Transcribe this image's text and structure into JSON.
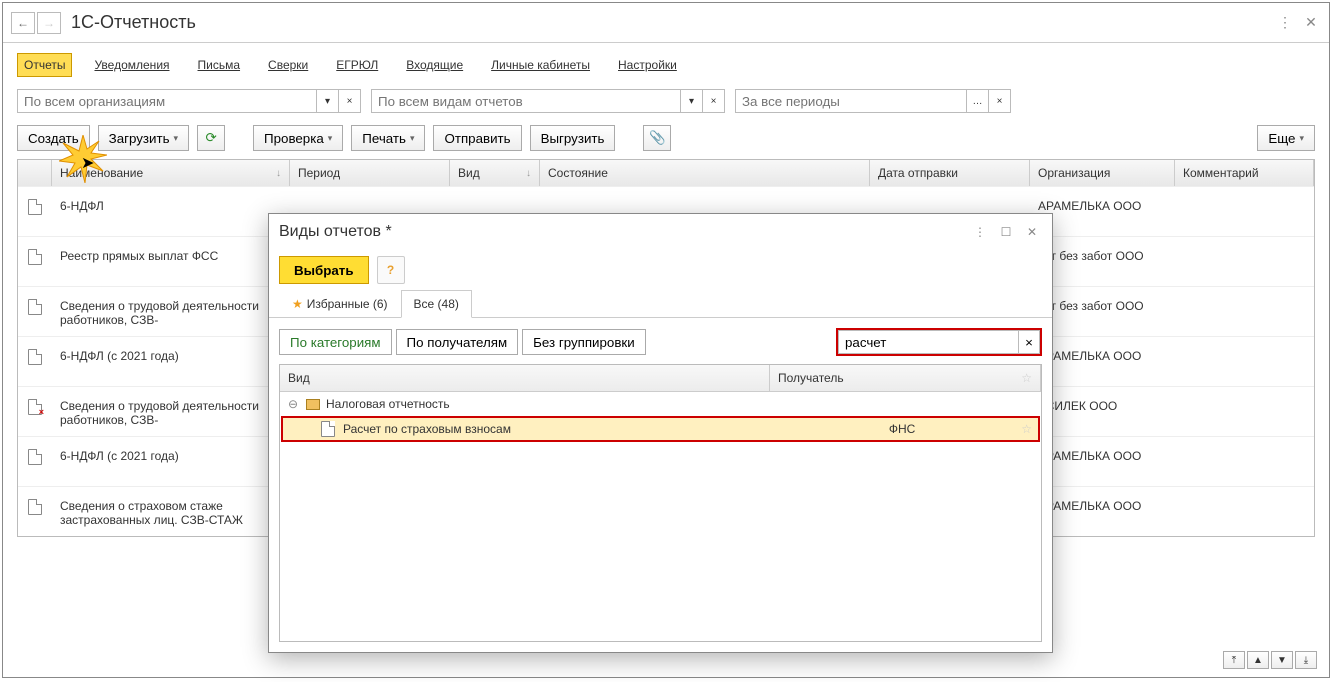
{
  "header": {
    "title": "1С-Отчетность"
  },
  "tabs": [
    "Отчеты",
    "Уведомления",
    "Письма",
    "Сверки",
    "ЕГРЮЛ",
    "Входящие",
    "Личные кабинеты",
    "Настройки"
  ],
  "filters": {
    "org_ph": "По всем организациям",
    "type_ph": "По всем видам отчетов",
    "period_ph": "За все периоды"
  },
  "actions": {
    "create": "Создать",
    "load": "Загрузить",
    "check": "Проверка",
    "print": "Печать",
    "send": "Отправить",
    "export": "Выгрузить",
    "more": "Еще"
  },
  "columns": {
    "name": "Наименование",
    "period": "Период",
    "kind": "Вид",
    "state": "Состояние",
    "sent": "Дата отправки",
    "org": "Организация",
    "comment": "Комментарий"
  },
  "rows": [
    {
      "name": "6-НДФЛ",
      "org": "АРАМЕЛЬКА ООО",
      "bad": false
    },
    {
      "name": "Реестр прямых выплат ФСС",
      "org": "чет без забот ООО",
      "bad": false
    },
    {
      "name": "Сведения о трудовой деятельности работников, СЗВ-",
      "org": "чет без забот ООО",
      "bad": false
    },
    {
      "name": "6-НДФЛ (с 2021 года)",
      "org": "АРАМЕЛЬКА ООО",
      "bad": false
    },
    {
      "name": "Сведения о трудовой деятельности работников, СЗВ-",
      "org": "АСИЛЕК ООО",
      "bad": true
    },
    {
      "name": "6-НДФЛ (с 2021 года)",
      "org": "АРАМЕЛЬКА ООО",
      "bad": false
    },
    {
      "name": "Сведения о страховом стаже застрахованных лиц. СЗВ-СТАЖ",
      "org": "АРАМЕЛЬКА ООО",
      "bad": false
    }
  ],
  "modal": {
    "title": "Виды отчетов *",
    "select": "Выбрать",
    "tab_fav": "Избранные (6)",
    "tab_all": "Все (48)",
    "g_cat": "По категориям",
    "g_rec": "По получателям",
    "g_none": "Без группировки",
    "search": "расчет",
    "col_kind": "Вид",
    "col_rec": "Получатель",
    "group_name": "Налоговая отчетность",
    "item_name": "Расчет по страховым взносам",
    "item_rec": "ФНС"
  }
}
